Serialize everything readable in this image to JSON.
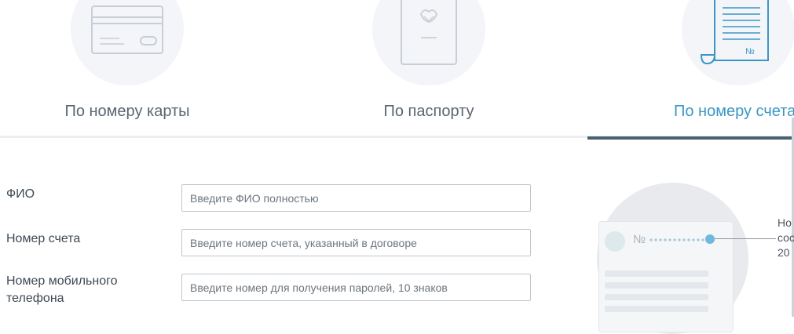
{
  "tabs": [
    {
      "label": "По номеру карты",
      "icon": "bank-card-icon",
      "active": false
    },
    {
      "label": "По паспорту",
      "icon": "passport-icon",
      "active": false
    },
    {
      "label": "По номеру счета",
      "icon": "account-contract-icon",
      "active": true
    }
  ],
  "account_symbol": "№",
  "form": {
    "fio": {
      "label": "ФИО",
      "placeholder": "Введите ФИО полностью"
    },
    "account": {
      "label": "Номер счета",
      "placeholder": "Введите номер счета, указанный в договоре"
    },
    "phone": {
      "label": "Номер мобильного телефона",
      "placeholder": "Введите номер для получения паролей, 10 знаков"
    }
  },
  "illustration": {
    "number_symbol": "№",
    "callout_lines": [
      "Но",
      "сос",
      "20"
    ]
  },
  "colors": {
    "active_tab": "#3a97c4",
    "active_bar": "#4a6170",
    "marker": "#6fb8de"
  }
}
